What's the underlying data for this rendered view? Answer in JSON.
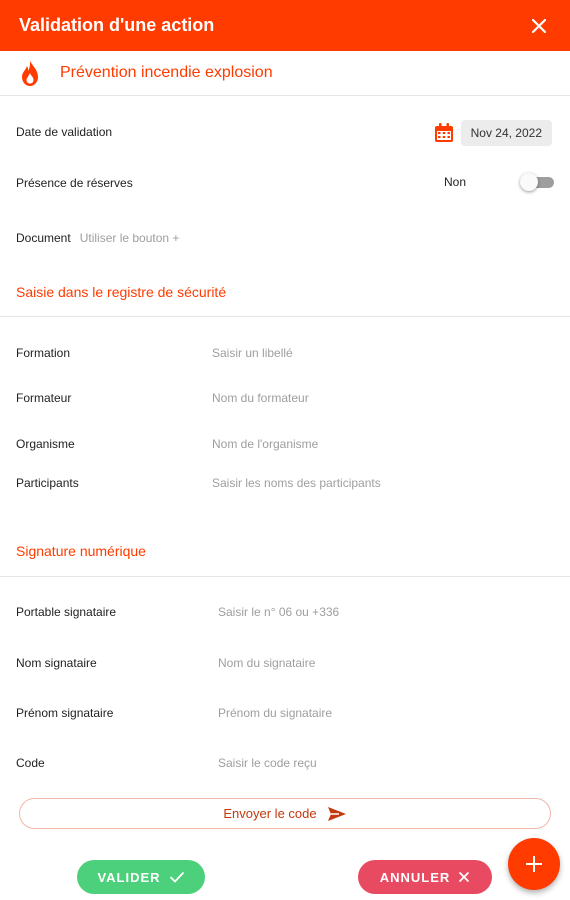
{
  "header": {
    "title": "Validation d'une action",
    "close_icon": "close-icon",
    "subtitle": "Prévention incendie explosion",
    "subtitle_icon": "flame-icon"
  },
  "general": {
    "date_label": "Date de validation",
    "date_value": "Nov 24, 2022",
    "reserves_label": "Présence de réserves",
    "reserves_value": "Non",
    "reserves_toggle_on": false,
    "document_label": "Document",
    "document_hint": "Utiliser le bouton +"
  },
  "registre": {
    "title": "Saisie dans le registre de sécurité",
    "fields": [
      {
        "label": "Formation",
        "placeholder": "Saisir un libellé"
      },
      {
        "label": "Formateur",
        "placeholder": "Nom du formateur"
      },
      {
        "label": "Organisme",
        "placeholder": "Nom de l'organisme"
      },
      {
        "label": "Participants",
        "placeholder": "Saisir les noms des participants"
      }
    ]
  },
  "signature": {
    "title": "Signature numérique",
    "fields": [
      {
        "label": "Portable signataire",
        "placeholder": "Saisir le n° 06 ou +336"
      },
      {
        "label": "Nom signataire",
        "placeholder": "Nom du signataire"
      },
      {
        "label": "Prénom signataire",
        "placeholder": "Prénom du signataire"
      },
      {
        "label": "Code",
        "placeholder": "Saisir le code reçu"
      }
    ],
    "send_code_label": "Envoyer le code"
  },
  "actions": {
    "validate_label": "VALIDER",
    "cancel_label": "ANNULER",
    "fab_icon": "plus-icon"
  },
  "colors": {
    "primary": "#ff3b00",
    "validate": "#4cd07b",
    "cancel": "#e84a62"
  }
}
